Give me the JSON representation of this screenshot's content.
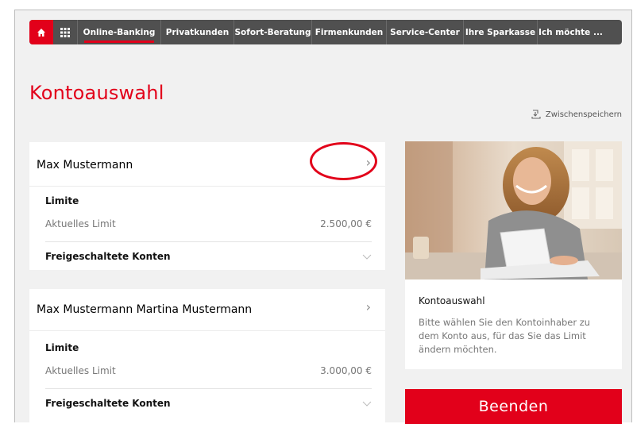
{
  "nav": {
    "items": [
      {
        "label": "Online-Banking"
      },
      {
        "label": "Privatkunden"
      },
      {
        "label": "Sofort-Beratung"
      },
      {
        "label": "Firmenkunden"
      },
      {
        "label": "Service-Center"
      },
      {
        "label": "Ihre Sparkasse"
      },
      {
        "label": "Ich möchte ..."
      }
    ]
  },
  "page": {
    "title": "Kontoauswahl",
    "save_label": "Zwischenspeichern"
  },
  "accounts": [
    {
      "holder": "Max Mustermann",
      "limit_heading": "Limite",
      "current_limit_label": "Aktuelles Limit",
      "current_limit_value": "2.500,00 €",
      "unlocked_label": "Freigeschaltete Konten"
    },
    {
      "holder": "Max Mustermann Martina Mustermann",
      "limit_heading": "Limite",
      "current_limit_label": "Aktuelles Limit",
      "current_limit_value": "3.000,00 €",
      "unlocked_label": "Freigeschaltete Konten"
    }
  ],
  "info": {
    "heading": "Kontoauswahl",
    "text": "Bitte wählen Sie den Kontoinhaber zu dem Konto aus, für das Sie das Limit ändern möchten."
  },
  "actions": {
    "finish_label": "Beenden"
  },
  "colors": {
    "brand_red": "#e2001a",
    "nav_gray": "#505050"
  }
}
